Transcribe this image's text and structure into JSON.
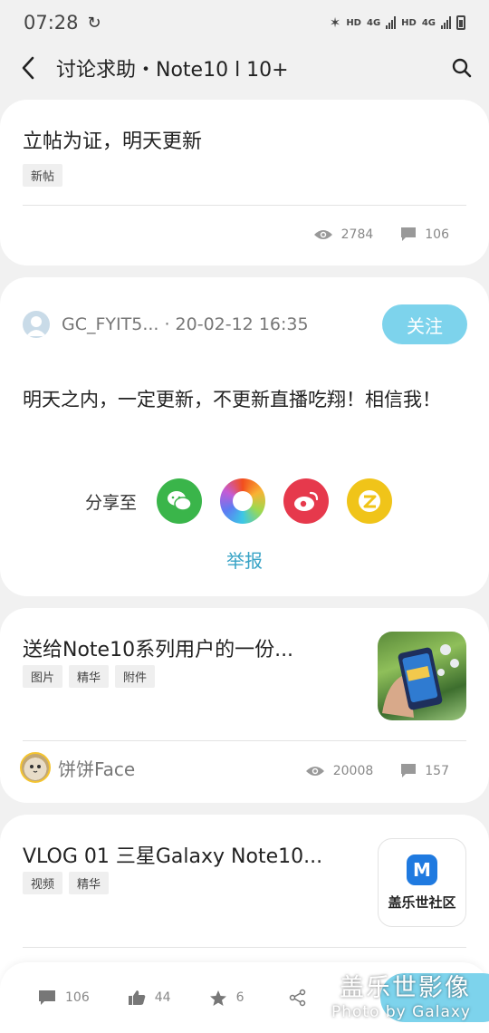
{
  "status": {
    "time": "07:28",
    "net1": "HD",
    "net2": "4G",
    "net3": "HD",
    "net4": "4G"
  },
  "header": {
    "title": "讨论求助・Note10 l 10+"
  },
  "post1": {
    "title": "立帖为证，明天更新",
    "tags": [
      "新帖"
    ],
    "views": "2784",
    "comments": "106"
  },
  "post_detail": {
    "author": "GC_FYIT5...",
    "meta": "· 20-02-12 16:35",
    "follow_label": "关注",
    "body": "明天之内，一定更新，不更新直播吃翔！相信我！",
    "share_label": "分享至",
    "report_label": "举报"
  },
  "post2": {
    "title": "送给Note10系列用户的一份...",
    "tags": [
      "图片",
      "精华",
      "附件"
    ],
    "author": "饼饼Face",
    "views": "20008",
    "comments": "157"
  },
  "post3": {
    "title": "VLOG 01 三星Galaxy Note10...",
    "tags": [
      "视频",
      "精华"
    ],
    "logo_mark": "M",
    "logo_text": "盖乐世社区"
  },
  "bottom_bar": {
    "comments": "106",
    "likes": "44",
    "stars": "6"
  },
  "watermark": {
    "line1": "盖乐世影像",
    "line2": "Photo by Galaxy"
  },
  "colors": {
    "accent": "#7dd3ec",
    "link": "#37a3c6",
    "wechat": "#3ab54a",
    "weibo": "#e6394c",
    "qzone": "#f0c419"
  }
}
